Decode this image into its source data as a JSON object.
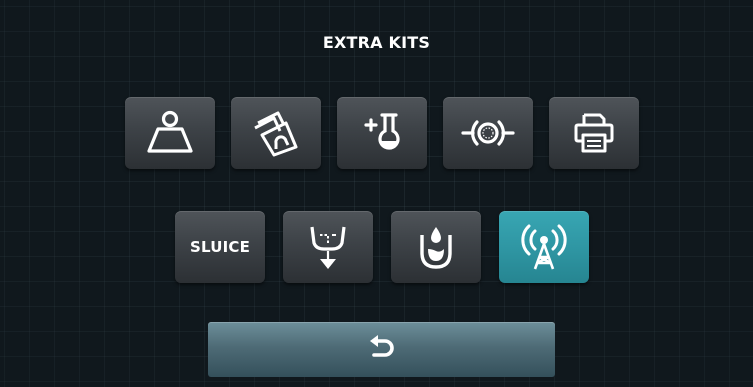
{
  "screen": {
    "title": "EXTRA KITS"
  },
  "kits_row1": [
    {
      "icon": "weight-icon"
    },
    {
      "icon": "tilting-drum-icon"
    },
    {
      "icon": "add-detergent-icon"
    },
    {
      "icon": "pump-icon"
    },
    {
      "icon": "printer-icon"
    }
  ],
  "kits_row2": [
    {
      "label": "SLUICE"
    },
    {
      "icon": "drain-funnel-icon"
    },
    {
      "icon": "water-drop-tank-icon"
    },
    {
      "icon": "wireless-antenna-icon",
      "active": true
    }
  ],
  "back_button": {
    "icon": "return-arrow-icon"
  },
  "colors": {
    "background": "#10181d",
    "button": "#3d4247",
    "active_button": "#2e95a2",
    "back_button": "#4e6b76",
    "text": "#ffffff"
  }
}
